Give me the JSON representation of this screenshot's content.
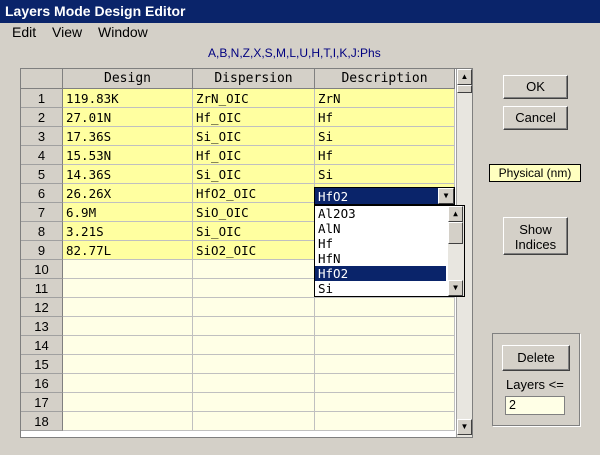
{
  "window": {
    "title": "Layers Mode Design Editor"
  },
  "menu": {
    "items": [
      "Edit",
      "View",
      "Window"
    ]
  },
  "codes_label": "A,B,N,Z,X,S,M,L,U,H,T,I,K,J:Phs",
  "grid": {
    "columns": [
      "Design",
      "Dispersion",
      "Description"
    ],
    "rows": [
      {
        "n": "1",
        "design": "119.83K",
        "dispersion": "ZrN_OIC",
        "description": "ZrN"
      },
      {
        "n": "2",
        "design": "27.01N",
        "dispersion": "Hf_OIC",
        "description": "Hf"
      },
      {
        "n": "3",
        "design": "17.36S",
        "dispersion": "Si_OIC",
        "description": "Si"
      },
      {
        "n": "4",
        "design": "15.53N",
        "dispersion": "Hf_OIC",
        "description": "Hf"
      },
      {
        "n": "5",
        "design": "14.36S",
        "dispersion": "Si_OIC",
        "description": "Si"
      },
      {
        "n": "6",
        "design": "26.26X",
        "dispersion": "HfO2_OIC",
        "description": ""
      },
      {
        "n": "7",
        "design": "6.9M",
        "dispersion": "SiO_OIC",
        "description": ""
      },
      {
        "n": "8",
        "design": "3.21S",
        "dispersion": "Si_OIC",
        "description": ""
      },
      {
        "n": "9",
        "design": "82.77L",
        "dispersion": "SiO2_OIC",
        "description": ""
      },
      {
        "n": "10",
        "design": "",
        "dispersion": "",
        "description": ""
      },
      {
        "n": "11",
        "design": "",
        "dispersion": "",
        "description": ""
      },
      {
        "n": "12",
        "design": "",
        "dispersion": "",
        "description": ""
      },
      {
        "n": "13",
        "design": "",
        "dispersion": "",
        "description": ""
      },
      {
        "n": "14",
        "design": "",
        "dispersion": "",
        "description": ""
      },
      {
        "n": "15",
        "design": "",
        "dispersion": "",
        "description": ""
      },
      {
        "n": "16",
        "design": "",
        "dispersion": "",
        "description": ""
      },
      {
        "n": "17",
        "design": "",
        "dispersion": "",
        "description": ""
      },
      {
        "n": "18",
        "design": "",
        "dispersion": "",
        "description": ""
      }
    ]
  },
  "combo": {
    "value": "HfO2",
    "options": [
      "Al2O3",
      "AlN",
      "Hf",
      "HfN",
      "HfO2",
      "Si"
    ],
    "selected": "HfO2"
  },
  "buttons": {
    "ok": "OK",
    "cancel": "Cancel",
    "show_indices_line1": "Show",
    "show_indices_line2": "Indices",
    "delete": "Delete"
  },
  "units_label": "Physical (nm)",
  "layers": {
    "label": "Layers <=",
    "value": "2"
  },
  "colors": {
    "title_bar": "#0a246a",
    "filled_cell": "#ffffa0",
    "empty_cell": "#ffffe6",
    "selection": "#0a246a"
  }
}
